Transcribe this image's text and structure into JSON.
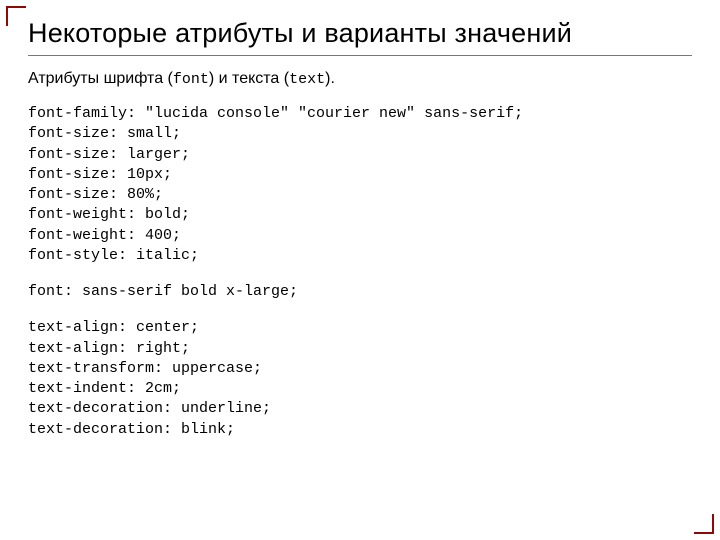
{
  "title": "Некоторые атрибуты и варианты значений",
  "subtitle_prefix": "Атрибуты шрифта (",
  "subtitle_mid": ") и текста (",
  "subtitle_suffix": ").",
  "mono_font": "font",
  "mono_text": "text",
  "code1": "font-family: \"lucida console\" \"courier new\" sans-serif;\nfont-size: small;\nfont-size: larger;\nfont-size: 10px;\nfont-size: 80%;\nfont-weight: bold;\nfont-weight: 400;\nfont-style: italic;",
  "code2": "font: sans-serif bold x-large;",
  "code3": "text-align: center;\ntext-align: right;\ntext-transform: uppercase;\ntext-indent: 2cm;\ntext-decoration: underline;\ntext-decoration: blink;"
}
